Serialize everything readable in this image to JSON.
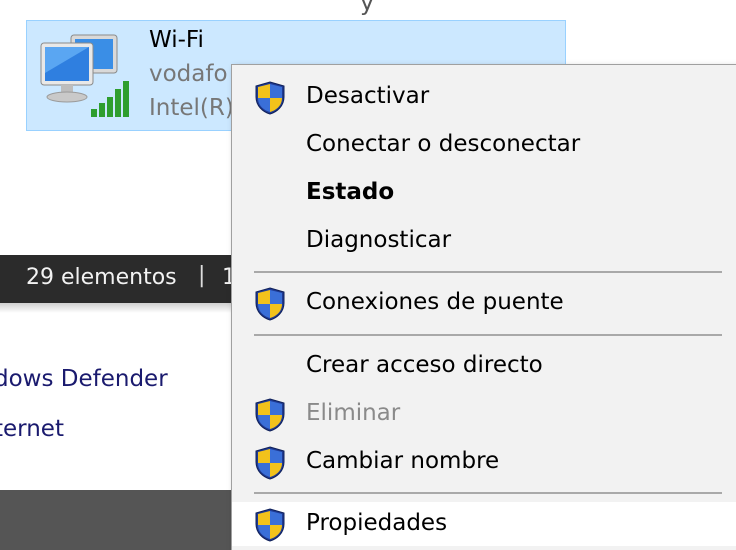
{
  "top_fragment": "y",
  "network_item": {
    "name": "Wi-Fi",
    "ssid_partial": "vodafo",
    "adapter_partial": "Intel(R)"
  },
  "statusbar": {
    "count": "29 elementos",
    "separator": "|",
    "extra": "1"
  },
  "background_links": [
    "dows Defender",
    "ternet"
  ],
  "context_menu": {
    "items": [
      {
        "label": "Desactivar",
        "shield": true
      },
      {
        "label": "Conectar o desconectar",
        "shield": false
      },
      {
        "label": "Estado",
        "shield": false,
        "bold": true
      },
      {
        "label": "Diagnosticar",
        "shield": false
      },
      {
        "label": "Conexiones de puente",
        "shield": true
      },
      {
        "label": "Crear acceso directo",
        "shield": false
      },
      {
        "label": "Eliminar",
        "shield": true,
        "disabled": true
      },
      {
        "label": "Cambiar nombre",
        "shield": true
      },
      {
        "label": "Propiedades",
        "shield": true,
        "highlighted": true
      }
    ]
  },
  "icons": {
    "network_adapter": "network-computer-icon",
    "signal": "wifi-signal-bars-icon",
    "uac_shield": "uac-shield-icon"
  },
  "colors": {
    "selection_bg": "#cce8ff",
    "selection_border": "#99d1ff",
    "statusbar_bg": "#2b2b2b",
    "menu_bg": "#f2f2f2",
    "disabled_text": "#8a8a8a"
  }
}
